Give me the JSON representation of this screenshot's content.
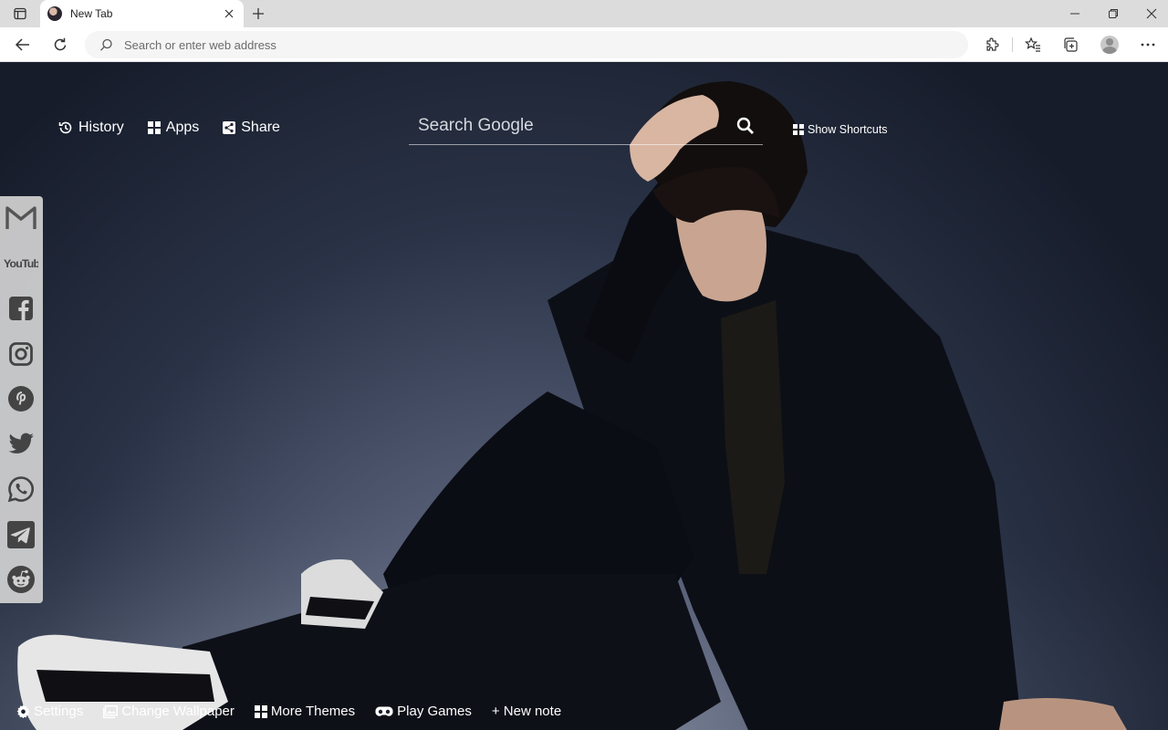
{
  "browser": {
    "tab_title": "New Tab",
    "address_placeholder": "Search or enter web address"
  },
  "newtab": {
    "top_links": [
      {
        "label": "History",
        "icon": "history-icon"
      },
      {
        "label": "Apps",
        "icon": "apps-grid-icon"
      },
      {
        "label": "Share",
        "icon": "share-icon"
      }
    ],
    "search_placeholder": "Search Google",
    "show_shortcuts_label": "Show Shortcuts",
    "social_links": [
      "gmail-icon",
      "youtube-icon",
      "facebook-icon",
      "instagram-icon",
      "pinterest-icon",
      "twitter-icon",
      "whatsapp-icon",
      "telegram-icon",
      "reddit-icon"
    ],
    "youtube_text": "YouTube",
    "bottom_links": [
      {
        "label": "Settings",
        "icon": "gear-icon"
      },
      {
        "label": "Change Wallpaper",
        "icon": "wallpaper-icon"
      },
      {
        "label": "More Themes",
        "icon": "themes-grid-icon"
      },
      {
        "label": "Play Games",
        "icon": "gamepad-icon"
      },
      {
        "label": "+ New note",
        "icon": ""
      }
    ]
  },
  "colors": {
    "chrome_bg": "#dcdcdc",
    "toolbar_bg": "#ffffff",
    "sidebar_bg": "#d2d2d2",
    "text_on_wallpaper": "#ffffff"
  }
}
